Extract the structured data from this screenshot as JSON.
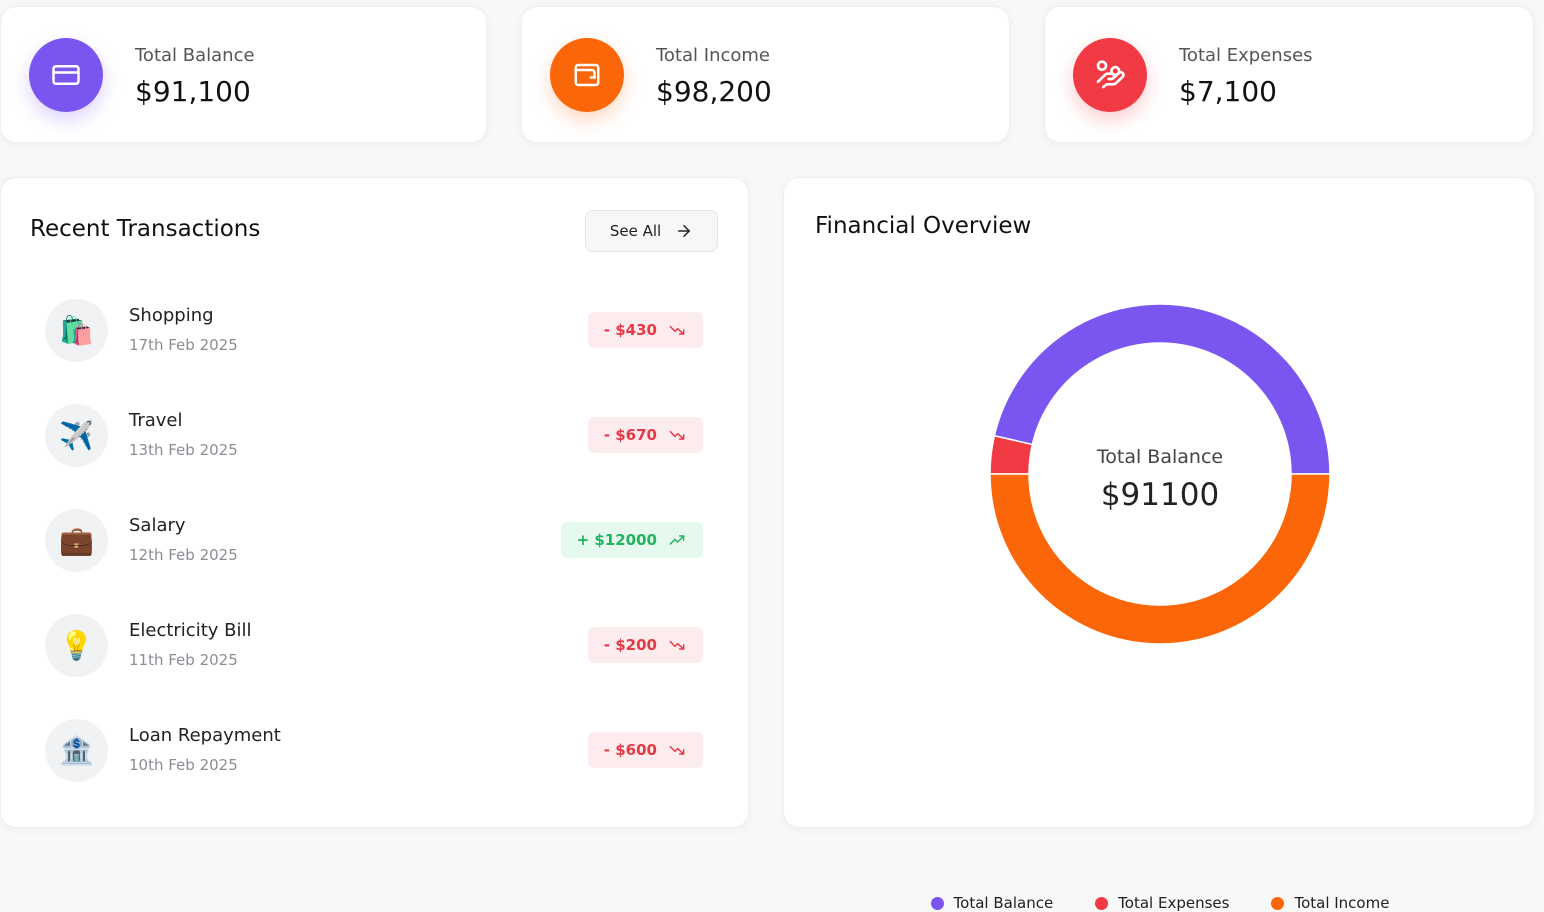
{
  "stats": [
    {
      "label": "Total Balance",
      "value": "$91,100",
      "color": "#7b55f0",
      "icon": "card-icon"
    },
    {
      "label": "Total Income",
      "value": "$98,200",
      "color": "#fa6608",
      "icon": "wallet-icon"
    },
    {
      "label": "Total Expenses",
      "value": "$7,100",
      "color": "#f23a45",
      "icon": "hand-coins-icon"
    }
  ],
  "transactions": {
    "title": "Recent Transactions",
    "see_all": "See All",
    "items": [
      {
        "emoji": "🛍️",
        "name": "Shopping",
        "date": "17th Feb 2025",
        "amount": "- $430",
        "type": "expense"
      },
      {
        "emoji": "✈️",
        "name": "Travel",
        "date": "13th Feb 2025",
        "amount": "- $670",
        "type": "expense"
      },
      {
        "emoji": "💼",
        "name": "Salary",
        "date": "12th Feb 2025",
        "amount": "+ $12000",
        "type": "income"
      },
      {
        "emoji": "💡",
        "name": "Electricity Bill",
        "date": "11th Feb 2025",
        "amount": "- $200",
        "type": "expense"
      },
      {
        "emoji": "🏦",
        "name": "Loan Repayment",
        "date": "10th Feb 2025",
        "amount": "- $600",
        "type": "expense"
      }
    ]
  },
  "overview": {
    "title": "Financial Overview",
    "center_label": "Total Balance",
    "center_value": "$91100",
    "legend": [
      {
        "label": "Total Balance",
        "color": "#7b55f0"
      },
      {
        "label": "Total Expenses",
        "color": "#f23a45"
      },
      {
        "label": "Total Income",
        "color": "#fa6608"
      }
    ]
  },
  "chart_data": {
    "type": "pie",
    "donut": true,
    "categories": [
      "Total Balance",
      "Total Expenses",
      "Total Income"
    ],
    "values": [
      91100,
      7100,
      98200
    ],
    "colors": [
      "#7b55f0",
      "#f23a45",
      "#fa6608"
    ],
    "legend_placement": "bottom"
  }
}
